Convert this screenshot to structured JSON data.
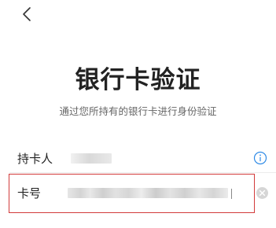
{
  "header": {
    "back_icon": "chevron-left-icon",
    "title": "银行卡验证",
    "subtitle": "通过您所持有的银行卡进行身份验证"
  },
  "form": {
    "holder": {
      "label": "持卡人",
      "value_state": "blurred",
      "info_icon": "info-circle-icon"
    },
    "card_number": {
      "label": "卡号",
      "value_state": "blurred",
      "clear_icon": "clear-circle-icon"
    }
  },
  "colors": {
    "accent_blue": "#2e8ae6",
    "highlight_red": "#d23b3b",
    "title_text": "#222222",
    "subtitle_text": "#666666"
  }
}
